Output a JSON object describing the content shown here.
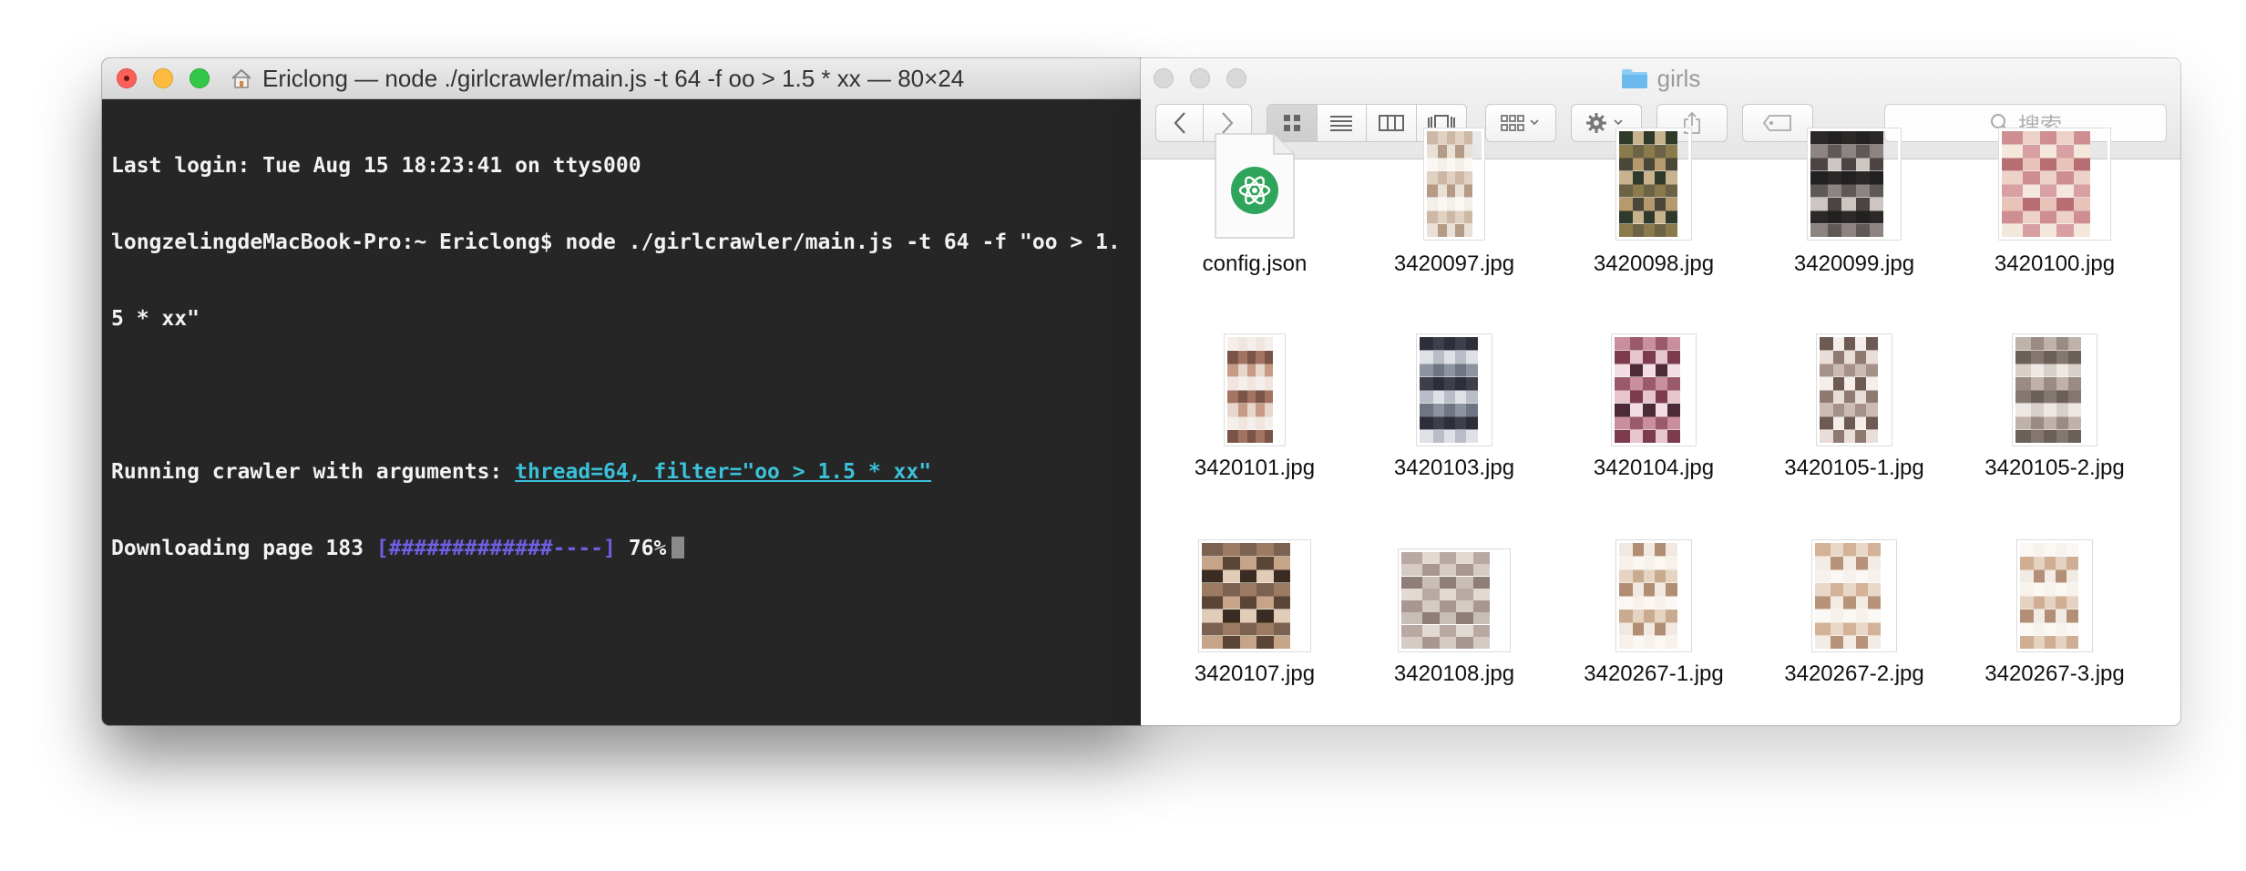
{
  "terminal": {
    "title": "Ericlong — node ./girlcrawler/main.js -t 64 -f oo > 1.5 * xx — 80×24",
    "lines": {
      "last_login": "Last login: Tue Aug 15 18:23:41 on ttys000",
      "cmd_line1": "longzelingdeMacBook-Pro:~ Ericlong$ node ./girlcrawler/main.js -t 64 -f \"oo > 1.",
      "cmd_line2": "5 * xx\"",
      "running_prefix": "Running crawler with arguments: ",
      "running_args": "thread=64, filter=\"oo > 1.5 * xx\"",
      "download_prefix": "Downloading page 183 ",
      "progress_bar": "[#############----]",
      "progress_percent": "76%"
    },
    "progress": 0.76
  },
  "finder": {
    "title": "girls",
    "search_placeholder": "搜索",
    "files": [
      {
        "name": "config.json",
        "kind": "json"
      },
      {
        "name": "3420097.jpg",
        "kind": "image"
      },
      {
        "name": "3420098.jpg",
        "kind": "image"
      },
      {
        "name": "3420099.jpg",
        "kind": "image"
      },
      {
        "name": "3420100.jpg",
        "kind": "image"
      },
      {
        "name": "3420101.jpg",
        "kind": "image"
      },
      {
        "name": "3420103.jpg",
        "kind": "image"
      },
      {
        "name": "3420104.jpg",
        "kind": "image"
      },
      {
        "name": "3420105-1.jpg",
        "kind": "image"
      },
      {
        "name": "3420105-2.jpg",
        "kind": "image"
      },
      {
        "name": "3420107.jpg",
        "kind": "image"
      },
      {
        "name": "3420108.jpg",
        "kind": "image"
      },
      {
        "name": "3420267-1.jpg",
        "kind": "image"
      },
      {
        "name": "3420267-2.jpg",
        "kind": "image"
      },
      {
        "name": "3420267-3.jpg",
        "kind": "image"
      }
    ]
  },
  "colors": {
    "terminal_bg": "#262626",
    "terminal_text": "#f2f2f2",
    "args_link": "#3bc1d9",
    "progress_bar": "#6d5fe0",
    "close_red": "#fc605b",
    "minimize_yellow": "#fdbc40",
    "zoom_green": "#34c84a"
  },
  "icons": [
    "home-icon",
    "folder-icon",
    "back-chevron-icon",
    "forward-chevron-icon",
    "icon-view-icon",
    "list-view-icon",
    "column-view-icon",
    "cover-flow-icon",
    "arrange-icon",
    "gear-icon",
    "share-icon",
    "tag-icon",
    "search-icon",
    "atom-json-icon"
  ]
}
